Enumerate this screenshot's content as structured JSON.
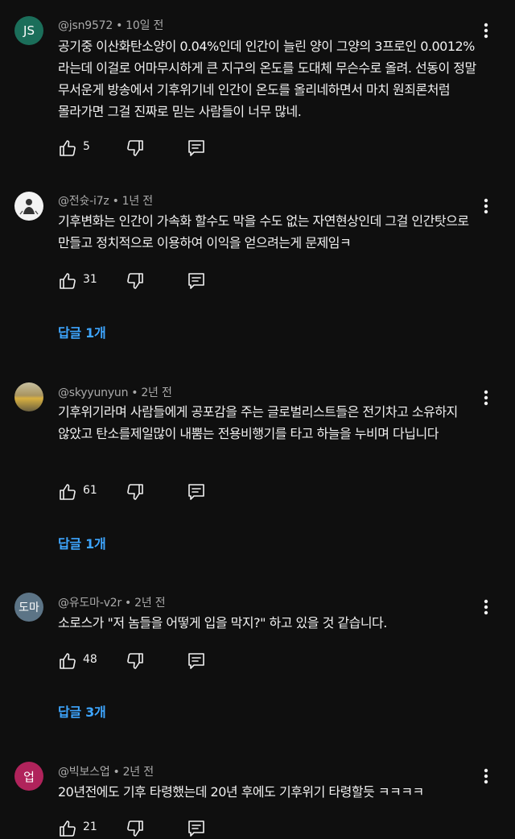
{
  "comments": [
    {
      "avatar_text": "JS",
      "avatar_color": "#1b6e5a",
      "author": "@jsn9572",
      "time": "10일 전",
      "text": "공기중 이산화탄소양이 0.04%인데 인간이 늘린 양이 그양의 3프로인 0.0012%라는데 이걸로 어마무시하게 큰 지구의 온도를 도대체 무슨수로 올려. 선동이 정말 무서운게 방송에서 기후위기네 인간이 온도를 올리네하면서 마치 원죄론처럼 몰라가면 그걸 진짜로 믿는 사람들이 너무 많네.",
      "likes": "5"
    },
    {
      "avatar_text": "",
      "avatar_color": "#f2f2f2",
      "author": "@전슛-i7z",
      "time": "1년 전",
      "text": "기후변화는 인간이 가속화 할수도 막을 수도 없는 자연현상인데 그걸 인간탓으로 만들고 정치적으로 이용하여 이익을 얻으려는게 문제임ㅋ",
      "likes": "31",
      "replies": "답글 1개"
    },
    {
      "avatar_text": "",
      "avatar_color": "#8a7a5a",
      "author": "@skyyunyun",
      "time": "2년 전",
      "text": "기후위기라며 사람들에게 공포감을 주는 글로벌리스트들은 전기차고 소유하지 않았고 탄소를제일많이 내뿜는 전용비행기를 타고 하늘을 누비며 다닙니다",
      "likes": "61",
      "replies": "답글 1개"
    },
    {
      "avatar_text": "도마",
      "avatar_color": "#5c7486",
      "author": "@유도마-v2r",
      "time": "2년 전",
      "text": "소로스가 \"저 놈들을 어떻게 입을 막지?\" 하고 있을 것 같습니다.",
      "likes": "48",
      "replies": "답글 3개"
    },
    {
      "avatar_text": "업",
      "avatar_color": "#b0235b",
      "author": "@빅보스업",
      "time": "2년 전",
      "text": "20년전에도 기후 타령했는데 20년 후에도 기후위기 타령할듯 ㅋㅋㅋㅋ",
      "likes": "21"
    }
  ]
}
